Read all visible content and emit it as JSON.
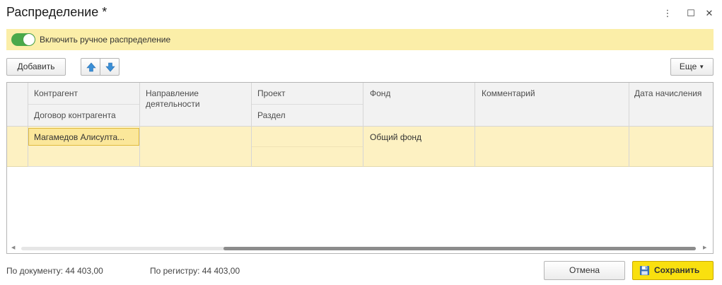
{
  "window": {
    "title": "Распределение *",
    "controls": {
      "menu": "⋮",
      "maximize": "☐",
      "close": "✕"
    }
  },
  "banner": {
    "toggle_on": true,
    "label": "Включить ручное распределение"
  },
  "toolbar": {
    "add_label": "Добавить",
    "up_icon": "arrow-up-icon",
    "down_icon": "arrow-down-icon",
    "more_label": "Еще"
  },
  "table": {
    "headers": {
      "counterparty": "Контрагент",
      "contract": "Договор контрагента",
      "direction": "Направление деятельности",
      "project": "Проект",
      "section": "Раздел",
      "fund": "Фонд",
      "comment": "Комментарий",
      "accrual_date": "Дата начисления"
    },
    "rows": [
      {
        "counterparty": "Магамедов Алисулта...",
        "contract": "",
        "direction": "",
        "project": "",
        "section": "",
        "fund": "Общий фонд",
        "comment": "",
        "accrual_date": ""
      }
    ],
    "scroll_left": "◀",
    "scroll_right": "▶"
  },
  "footer": {
    "by_document": "По документу:  44 403,00",
    "by_register": "По регистру:  44 403,00",
    "cancel_label": "Отмена",
    "save_label": "Сохранить"
  },
  "colors": {
    "banner_bg": "#fbeea8",
    "toggle_on": "#4aa94a",
    "row_highlight": "#fdf1c2",
    "save_button": "#f9e00f",
    "arrow_icon": "#3a8fd6"
  }
}
